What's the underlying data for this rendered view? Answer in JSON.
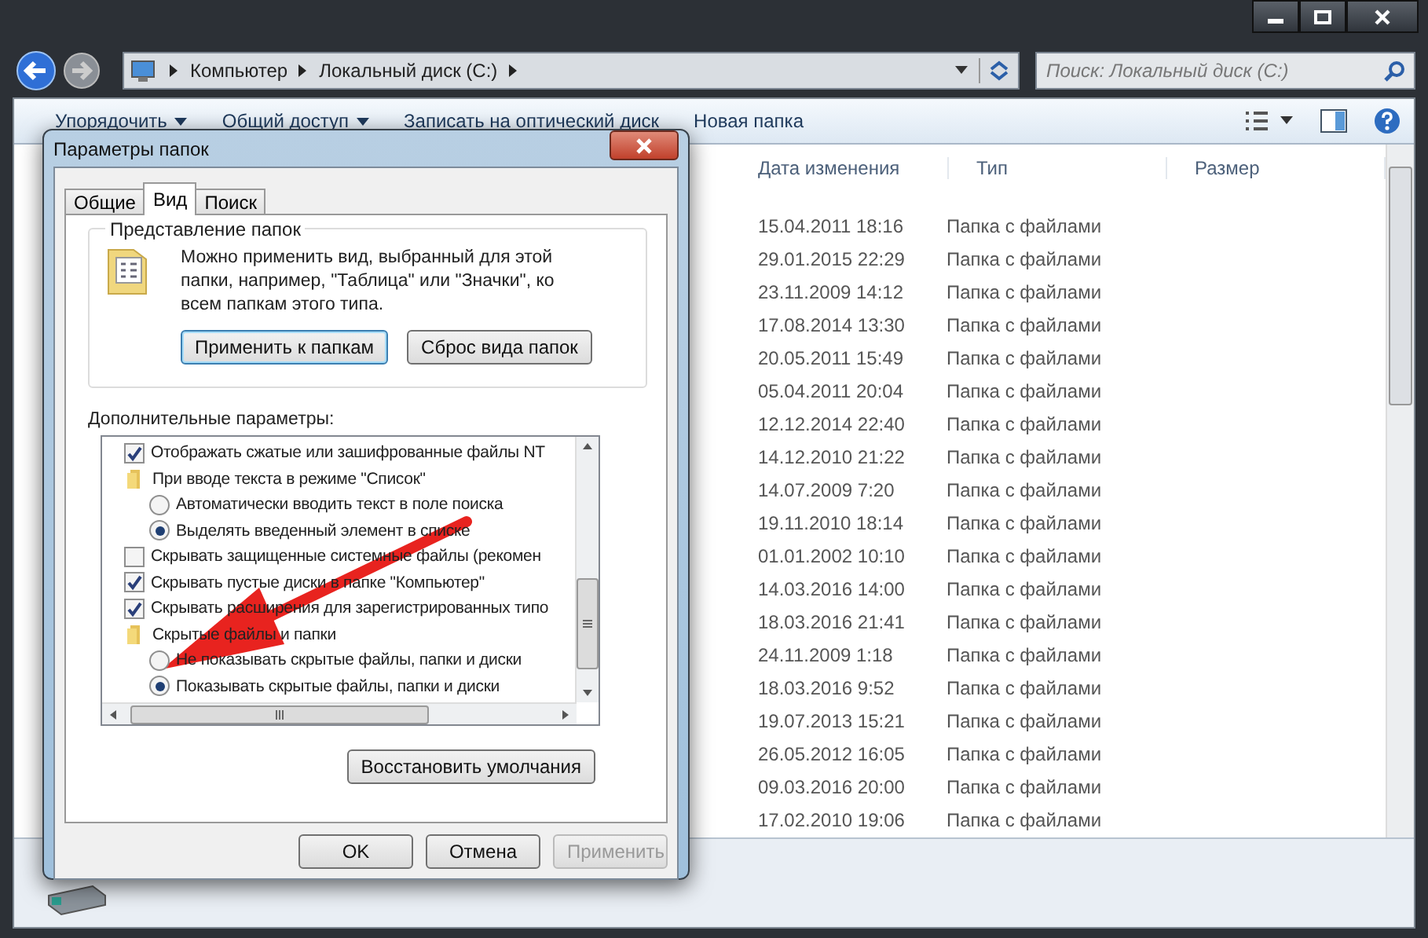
{
  "explorer": {
    "breadcrumb": [
      "Компьютер",
      "Локальный диск (C:)"
    ],
    "search": {
      "placeholder": "Поиск: Локальный диск (C:)"
    },
    "toolbar": [
      {
        "label": "Упорядочить",
        "dropdown": true
      },
      {
        "label": "Общий доступ",
        "dropdown": true
      },
      {
        "label": "Записать на оптический диск",
        "dropdown": false
      },
      {
        "label": "Новая папка",
        "dropdown": false
      }
    ],
    "columns": [
      "Дата изменения",
      "Тип",
      "Размер"
    ],
    "rows": [
      {
        "date": "15.04.2011 18:16",
        "type": "Папка с файлами"
      },
      {
        "date": "29.01.2015 22:29",
        "type": "Папка с файлами"
      },
      {
        "date": "23.11.2009 14:12",
        "type": "Папка с файлами"
      },
      {
        "date": "17.08.2014 13:30",
        "type": "Папка с файлами"
      },
      {
        "date": "20.05.2011 15:49",
        "type": "Папка с файлами"
      },
      {
        "date": "05.04.2011 20:04",
        "type": "Папка с файлами"
      },
      {
        "date": "12.12.2014 22:40",
        "type": "Папка с файлами"
      },
      {
        "date": "14.12.2010 21:22",
        "type": "Папка с файлами"
      },
      {
        "date": "14.07.2009 7:20",
        "type": "Папка с файлами"
      },
      {
        "date": "19.11.2010 18:14",
        "type": "Папка с файлами"
      },
      {
        "date": "01.01.2002 10:10",
        "type": "Папка с файлами"
      },
      {
        "date": "14.03.2016 14:00",
        "type": "Папка с файлами"
      },
      {
        "date": "18.03.2016 21:41",
        "type": "Папка с файлами"
      },
      {
        "date": "24.11.2009 1:18",
        "type": "Папка с файлами"
      },
      {
        "date": "18.03.2016 9:52",
        "type": "Папка с файлами"
      },
      {
        "date": "19.07.2013 15:21",
        "type": "Папка с файлами"
      },
      {
        "date": "26.05.2012 16:05",
        "type": "Папка с файлами"
      },
      {
        "date": "09.03.2016 20:00",
        "type": "Папка с файлами"
      },
      {
        "date": "17.02.2010 19:06",
        "type": "Папка с файлами"
      }
    ]
  },
  "dialog": {
    "title": "Параметры папок",
    "tabs": [
      {
        "label": "Общие",
        "selected": false
      },
      {
        "label": "Вид",
        "selected": true
      },
      {
        "label": "Поиск",
        "selected": false
      }
    ],
    "group": {
      "title": "Представление папок",
      "text": "Можно применить вид, выбранный для этой папки, например, \"Таблица\" или \"Значки\", ко всем папкам этого типа.",
      "buttons": [
        "Применить к папкам",
        "Сброс вида папок"
      ]
    },
    "advanced_label": "Дополнительные параметры:",
    "options": [
      {
        "kind": "checkbox",
        "label": "Отображать сжатые или зашифрованные файлы NT",
        "checked": true
      },
      {
        "kind": "folder",
        "label": "При вводе текста в режиме \"Список\""
      },
      {
        "kind": "radio",
        "label": "Автоматически вводить текст в поле поиска",
        "selected": false
      },
      {
        "kind": "radio",
        "label": "Выделять введенный элемент в списке",
        "selected": true
      },
      {
        "kind": "checkbox",
        "label": "Скрывать защищенные системные файлы (рекомен",
        "checked": false
      },
      {
        "kind": "checkbox",
        "label": "Скрывать пустые диски в папке \"Компьютер\"",
        "checked": true
      },
      {
        "kind": "checkbox",
        "label": "Скрывать расширения для зарегистрированных типо",
        "checked": true
      },
      {
        "kind": "folder",
        "label": "Скрытые файлы и папки"
      },
      {
        "kind": "radio",
        "label": "Не показывать скрытые файлы, папки и диски",
        "selected": false
      },
      {
        "kind": "radio",
        "label": "Показывать скрытые файлы, папки и диски",
        "selected": true
      }
    ],
    "restore_button": "Восстановить умолчания",
    "buttons": [
      {
        "label": "OK",
        "disabled": false
      },
      {
        "label": "Отмена",
        "disabled": false
      },
      {
        "label": "Применить",
        "disabled": true
      }
    ]
  }
}
